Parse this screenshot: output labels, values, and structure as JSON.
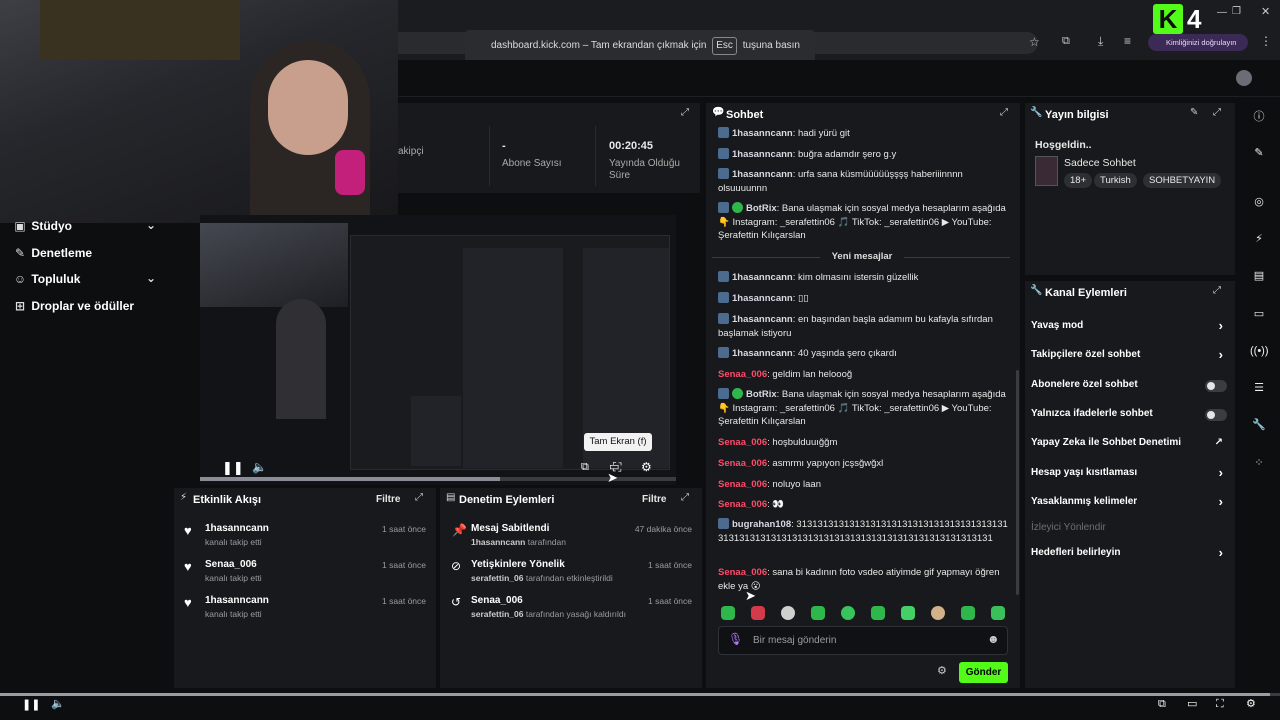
{
  "browser": {
    "fullscreen_notice_pre": "dashboard.kick.com – Tam ekrandan çıkmak için",
    "fullscreen_key": "Esc",
    "fullscreen_notice_post": "tuşuna basın",
    "profile_chip": "Kimliğinizi doğrulayın"
  },
  "overlay": {
    "logo_letter": "K",
    "logo_number": "4"
  },
  "stats": [
    {
      "value": "",
      "label": "akipçi"
    },
    {
      "value": "-",
      "label": "Abone Sayısı"
    },
    {
      "value": "00:20:45",
      "label": "Yayında Olduğu Süre"
    }
  ],
  "sidebar": {
    "items": [
      {
        "label": "Stüdyo",
        "icon": "studio-icon",
        "has_chevron": true
      },
      {
        "label": "Denetleme",
        "icon": "wrench-icon",
        "has_chevron": false
      },
      {
        "label": "Topluluk",
        "icon": "community-icon",
        "has_chevron": true
      },
      {
        "label": "Droplar ve ödüller",
        "icon": "gift-icon",
        "has_chevron": false
      }
    ]
  },
  "video": {
    "tooltip": "Tam Ekran (f)"
  },
  "activity_feed": {
    "title": "Etkinlik Akışı",
    "filter": "Filtre",
    "items": [
      {
        "name": "1hasanncann",
        "sub": "kanalı takip etti",
        "time": "1 saat önce"
      },
      {
        "name": "Senaa_006",
        "sub": "kanalı takip etti",
        "time": "1 saat önce"
      },
      {
        "name": "1hasanncann",
        "sub": "kanalı takip etti",
        "time": "1 saat önce"
      }
    ]
  },
  "mod_actions": {
    "title": "Denetim Eylemleri",
    "filter": "Filtre",
    "items": [
      {
        "name": "Mesaj Sabitlendi",
        "actor": "1hasanncann",
        "suffix": "tarafından",
        "time": "47 dakika önce"
      },
      {
        "name": "Yetişkinlere Yönelik",
        "actor": "serafettin_06",
        "suffix": "tarafından etkinleştirildi",
        "time": "1 saat önce"
      },
      {
        "name": "Senaa_006",
        "actor": "serafettin_06",
        "suffix": "tarafından yasağı kaldırıldı",
        "time": "1 saat önce"
      }
    ]
  },
  "chat": {
    "title": "Sohbet",
    "new_messages": "Yeni mesajlar",
    "input_placeholder": "Bir mesaj gönderin",
    "send": "Gönder",
    "messages": [
      {
        "user": "1hasanncann",
        "text": "hadi yürü git"
      },
      {
        "user": "1hasanncann",
        "text": "buğra adamdır şero g.y"
      },
      {
        "user": "1hasanncann",
        "text": "urfa sana küsmüüüüüşşşş haberiiinnnn olsuuuunnn"
      },
      {
        "user": "BotRix",
        "text": "Bana ulaşmak için sosyal medya hesaplarım aşağıda 👇 Instagram: _serafettin06 🎵 TikTok: _serafettin06 ▶ YouTube: Şerafettin Kılıçarslan"
      },
      {
        "user": "1hasanncann",
        "text": "kim olmasını istersin güzellik"
      },
      {
        "user": "1hasanncann",
        "text": "▯▯"
      },
      {
        "user": "1hasanncann",
        "text": "en başından başla adamım bu kafayla sıfırdan başlamak istiyoru"
      },
      {
        "user": "1hasanncann",
        "text": "40 yaşında şero çıkardı"
      },
      {
        "user": "Senaa_006",
        "text": "geldim lan heloooğ"
      },
      {
        "user": "BotRix",
        "text": "Bana ulaşmak için sosyal medya hesaplarım aşağıda 👇 Instagram: _serafettin06 🎵 TikTok: _serafettin06 ▶ YouTube: Şerafettin Kılıçarslan"
      },
      {
        "user": "Senaa_006",
        "text": "hoşbulduuığğm"
      },
      {
        "user": "Senaa_006",
        "text": "asmrmı yapıyon jcşsğwğxl"
      },
      {
        "user": "Senaa_006",
        "text": "noluyo laan"
      },
      {
        "user": "Senaa_006",
        "text": "👀"
      },
      {
        "user": "bugrahan108",
        "text": "31313131313131313131313131313131313131313131313131313131313131313131313131313131313131313131"
      },
      {
        "user": "Senaa_006",
        "text": "sana bi kadının foto vsdeo atiyimde gif yapmayı öğren ekle ya 😮"
      }
    ]
  },
  "stream_info": {
    "title": "Yayın bilgisi",
    "welcome": "Hoşgeldin..",
    "stream_title": "Sadece Sohbet",
    "tags": [
      "18+",
      "Turkish",
      "SOHBETYAYIN"
    ]
  },
  "channel_actions": {
    "title": "Kanal Eylemleri",
    "items": [
      {
        "label": "Yavaş mod",
        "control": "chevron"
      },
      {
        "label": "Takipçilere özel sohbet",
        "control": "chevron"
      },
      {
        "label": "Abonelere özel sohbet",
        "control": "toggle"
      },
      {
        "label": "Yalnızca ifadelerle sohbet",
        "control": "toggle"
      },
      {
        "label": "Yapay Zeka ile Sohbet Denetimi",
        "control": "external"
      },
      {
        "label": "Hesap yaşı kısıtlaması",
        "control": "chevron"
      },
      {
        "label": "Yasaklanmış kelimeler",
        "control": "chevron"
      },
      {
        "label": "İzleyici Yönlendir",
        "control": "none",
        "disabled": true
      },
      {
        "label": "Hedefleri belirleyin",
        "control": "chevron"
      }
    ]
  },
  "colors": {
    "accent": "#53fc18",
    "panel": "#18191c",
    "background": "#0d0e10",
    "username_red": "#ff4a6a"
  }
}
